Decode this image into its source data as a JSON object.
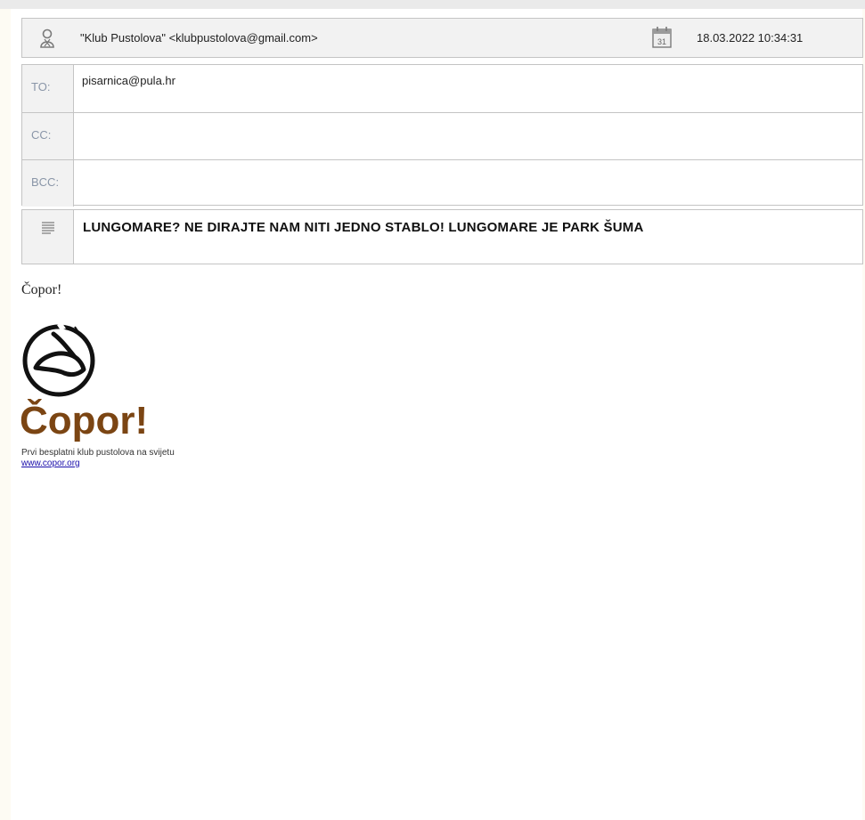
{
  "email": {
    "from": "\"Klub Pustolova\" <klubpustolova@gmail.com>",
    "date": "18.03.2022 10:34:31",
    "to_label": "TO:",
    "to_value": "pisarnica@pula.hr",
    "cc_label": "CC:",
    "cc_value": "",
    "bcc_label": "BCC:",
    "bcc_value": "",
    "subject": "LUNGOMARE? NE DIRAJTE NAM NITI JEDNO STABLO! LUNGOMARE JE PARK ŠUMA",
    "calendar_day": "31"
  },
  "body": {
    "greeting": "Čopor!",
    "logo_word": "Čopor!",
    "tagline": "Prvi besplatni klub pustolova na svijetu",
    "link": "www.copor.org"
  },
  "icons": {
    "sender": "sender-icon",
    "calendar": "calendar-icon",
    "subject": "subject-lines-icon",
    "logo": "copor-logo"
  },
  "colors": {
    "header_bg": "#f2f2f2",
    "border": "#c4c4c4",
    "label": "#8a96a8",
    "logo_brown": "#7b4513",
    "link": "#1a0dab"
  }
}
